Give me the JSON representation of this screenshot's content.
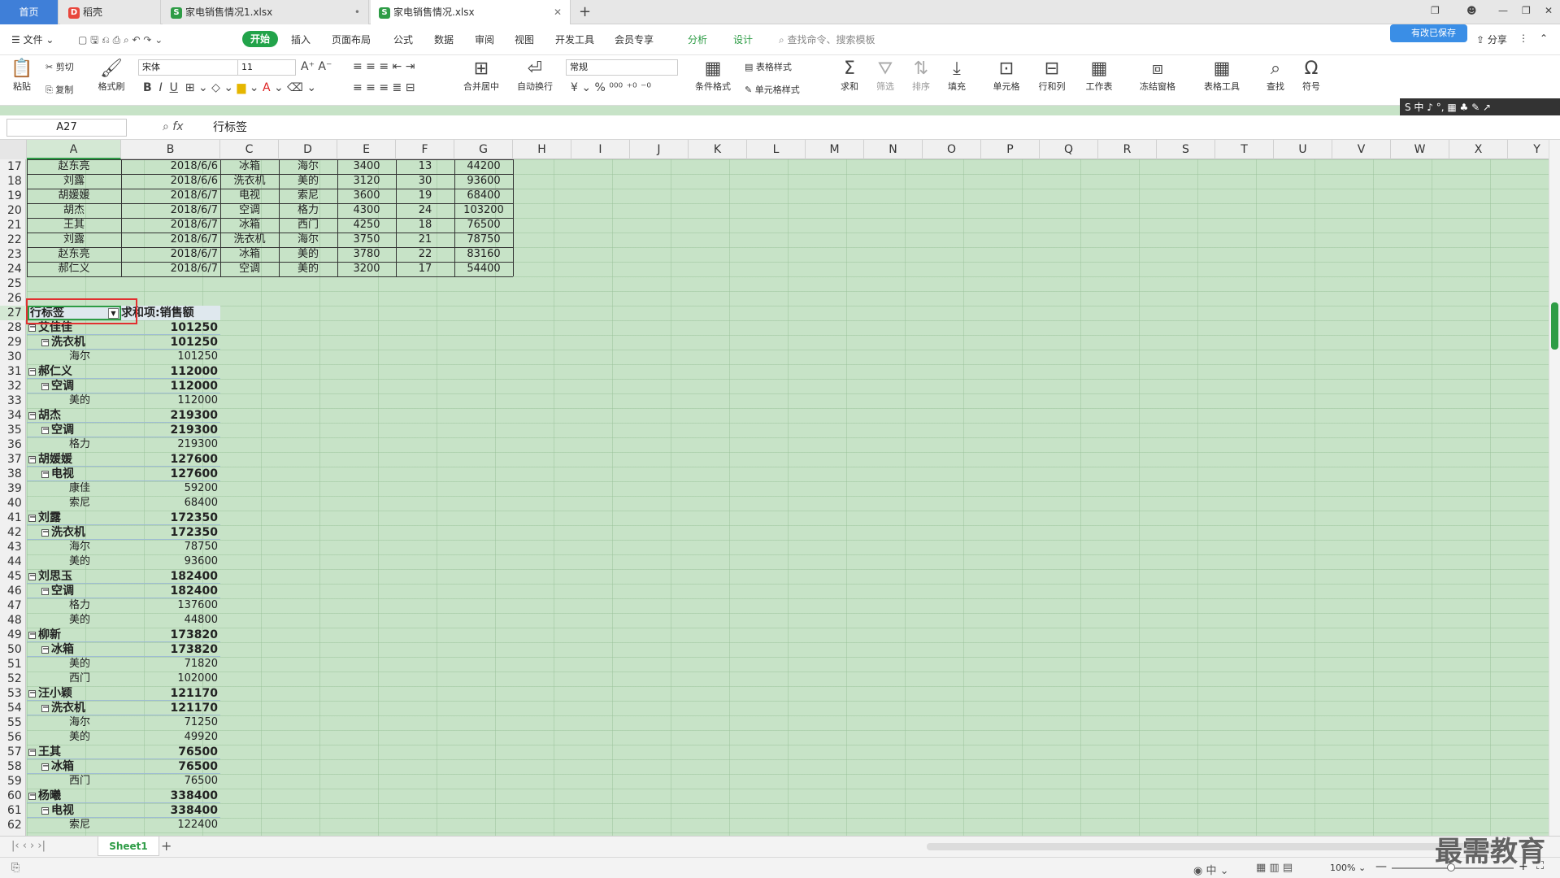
{
  "tabs": {
    "home": "首页",
    "t1": "稻壳",
    "t2": "家电销售情况1.xlsx",
    "t3": "家电销售情况.xlsx"
  },
  "menu": {
    "file": "文件",
    "start": "开始",
    "insert": "插入",
    "layout": "页面布局",
    "formula": "公式",
    "data": "数据",
    "review": "审阅",
    "view": "视图",
    "dev": "开发工具",
    "member": "会员专享",
    "analyze": "分析",
    "design": "设计",
    "search": "查找命令、搜索模板",
    "share": "分享",
    "cloud": "有改已保存"
  },
  "ribbon": {
    "paste": "粘贴",
    "cut": "剪切",
    "copy": "复制",
    "format_painter": "格式刷",
    "font": "宋体",
    "size": "11",
    "merge": "合并居中",
    "wrap": "自动换行",
    "numfmt": "常规",
    "cond": "条件格式",
    "tblstyle": "表格样式",
    "cellstyle": "单元格样式",
    "sum": "求和",
    "filter": "筛选",
    "sort": "排序",
    "fill": "填充",
    "cell": "单元格",
    "rowcol": "行和列",
    "sheet": "工作表",
    "freeze": "冻结窗格",
    "tools": "表格工具",
    "find": "查找",
    "symbol": "符号"
  },
  "ime": "S 中 ♪ °, ▦ ♣ ✎ ↗",
  "formula": {
    "namebox": "A27",
    "fx": "fx",
    "value": "行标签"
  },
  "columns": [
    "A",
    "B",
    "C",
    "D",
    "E",
    "F",
    "G",
    "H",
    "I",
    "J",
    "K",
    "L",
    "M",
    "N",
    "O",
    "P",
    "Q",
    "R",
    "S",
    "T",
    "U",
    "V",
    "W",
    "X",
    "Y"
  ],
  "rows": [
    "17",
    "18",
    "19",
    "20",
    "21",
    "22",
    "23",
    "24",
    "25",
    "26",
    "27",
    "28",
    "29",
    "30",
    "31",
    "32",
    "33",
    "34",
    "35",
    "36",
    "37",
    "38",
    "39",
    "40",
    "41",
    "42",
    "43",
    "44",
    "45",
    "46",
    "47",
    "48",
    "49",
    "50",
    "51",
    "52",
    "53",
    "54",
    "55",
    "56",
    "57",
    "58",
    "59",
    "60",
    "61",
    "62"
  ],
  "data_rows": [
    [
      "赵东亮",
      "2018/6/6",
      "冰箱",
      "海尔",
      "3400",
      "13",
      "44200"
    ],
    [
      "刘露",
      "2018/6/6",
      "洗衣机",
      "美的",
      "3120",
      "30",
      "93600"
    ],
    [
      "胡媛媛",
      "2018/6/7",
      "电视",
      "索尼",
      "3600",
      "19",
      "68400"
    ],
    [
      "胡杰",
      "2018/6/7",
      "空调",
      "格力",
      "4300",
      "24",
      "103200"
    ],
    [
      "王其",
      "2018/6/7",
      "冰箱",
      "西门",
      "4250",
      "18",
      "76500"
    ],
    [
      "刘露",
      "2018/6/7",
      "洗衣机",
      "海尔",
      "3750",
      "21",
      "78750"
    ],
    [
      "赵东亮",
      "2018/6/7",
      "冰箱",
      "美的",
      "3780",
      "22",
      "83160"
    ],
    [
      "郝仁义",
      "2018/6/7",
      "空调",
      "美的",
      "3200",
      "17",
      "54400"
    ]
  ],
  "pivot": {
    "header_label": "行标签",
    "header_value": "求和项:销售额",
    "rows": [
      {
        "level": 0,
        "label": "艾佳佳",
        "value": "101250"
      },
      {
        "level": 1,
        "label": "洗衣机",
        "value": "101250"
      },
      {
        "level": 2,
        "label": "海尔",
        "value": "101250"
      },
      {
        "level": 0,
        "label": "郝仁义",
        "value": "112000"
      },
      {
        "level": 1,
        "label": "空调",
        "value": "112000"
      },
      {
        "level": 2,
        "label": "美的",
        "value": "112000"
      },
      {
        "level": 0,
        "label": "胡杰",
        "value": "219300"
      },
      {
        "level": 1,
        "label": "空调",
        "value": "219300"
      },
      {
        "level": 2,
        "label": "格力",
        "value": "219300"
      },
      {
        "level": 0,
        "label": "胡媛媛",
        "value": "127600"
      },
      {
        "level": 1,
        "label": "电视",
        "value": "127600"
      },
      {
        "level": 2,
        "label": "康佳",
        "value": "59200"
      },
      {
        "level": 2,
        "label": "索尼",
        "value": "68400"
      },
      {
        "level": 0,
        "label": "刘露",
        "value": "172350"
      },
      {
        "level": 1,
        "label": "洗衣机",
        "value": "172350"
      },
      {
        "level": 2,
        "label": "海尔",
        "value": "78750"
      },
      {
        "level": 2,
        "label": "美的",
        "value": "93600"
      },
      {
        "level": 0,
        "label": "刘思玉",
        "value": "182400"
      },
      {
        "level": 1,
        "label": "空调",
        "value": "182400"
      },
      {
        "level": 2,
        "label": "格力",
        "value": "137600"
      },
      {
        "level": 2,
        "label": "美的",
        "value": "44800"
      },
      {
        "level": 0,
        "label": "柳新",
        "value": "173820"
      },
      {
        "level": 1,
        "label": "冰箱",
        "value": "173820"
      },
      {
        "level": 2,
        "label": "美的",
        "value": "71820"
      },
      {
        "level": 2,
        "label": "西门",
        "value": "102000"
      },
      {
        "level": 0,
        "label": "汪小颖",
        "value": "121170"
      },
      {
        "level": 1,
        "label": "洗衣机",
        "value": "121170"
      },
      {
        "level": 2,
        "label": "海尔",
        "value": "71250"
      },
      {
        "level": 2,
        "label": "美的",
        "value": "49920"
      },
      {
        "level": 0,
        "label": "王其",
        "value": "76500"
      },
      {
        "level": 1,
        "label": "冰箱",
        "value": "76500"
      },
      {
        "level": 2,
        "label": "西门",
        "value": "76500"
      },
      {
        "level": 0,
        "label": "杨曦",
        "value": "338400"
      },
      {
        "level": 1,
        "label": "电视",
        "value": "338400"
      },
      {
        "level": 2,
        "label": "索尼",
        "value": "122400"
      }
    ]
  },
  "sheet": "Sheet1",
  "zoom": "100%",
  "watermark": "最需教育"
}
